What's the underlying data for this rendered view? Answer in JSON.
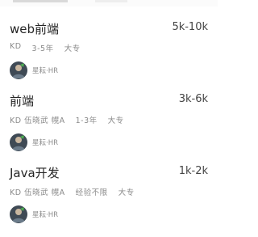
{
  "jobs": [
    {
      "title": "web前端",
      "salary": "5k-10k",
      "tags": [
        "KD",
        "3-5年",
        "大专"
      ],
      "recruiter": "星耘·HR"
    },
    {
      "title": "前端",
      "salary": "3k-6k",
      "tags": [
        "KD 伍晓武 幌A",
        "1-3年",
        "大专"
      ],
      "recruiter": "星耘·HR"
    },
    {
      "title": "Java开发",
      "salary": "1k-2k",
      "tags": [
        "KD 伍晓武 幌A",
        "经验不限",
        "大专"
      ],
      "recruiter": "星耘·HR"
    }
  ]
}
